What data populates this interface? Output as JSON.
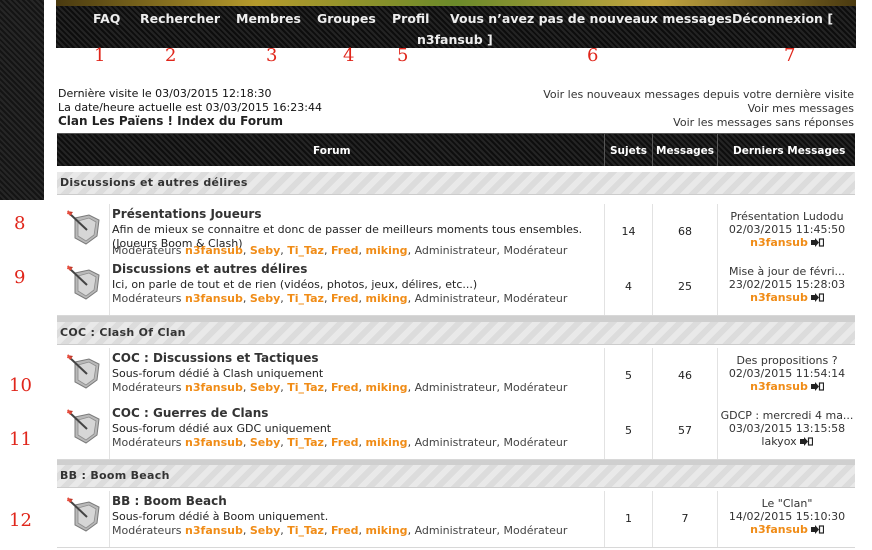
{
  "nav": {
    "faq": "FAQ",
    "search": "Rechercher",
    "members": "Membres",
    "groups": "Groupes",
    "profile": "Profil",
    "messages": "Vous n’avez pas de nouveaux messages",
    "logout_line1": "Déconnexion [",
    "logout_line2": "n3fansub ]"
  },
  "annotations": [
    "1",
    "2",
    "3",
    "4",
    "5",
    "6",
    "7",
    "8",
    "9",
    "10",
    "11",
    "12"
  ],
  "info": {
    "last_visit": "Dernière visite le 03/03/2015 12:18:30",
    "current_time": "La date/heure actuelle est 03/03/2015 16:23:44",
    "breadcrumb": "Clan Les Païens ! Index du Forum",
    "link_new": "Voir les nouveaux messages depuis votre dernière visite",
    "link_mine": "Voir mes messages",
    "link_unanswered": "Voir les messages sans réponses"
  },
  "table_header": {
    "forum": "Forum",
    "topics": "Sujets",
    "messages": "Messages",
    "last": "Derniers Messages"
  },
  "moderators_label": "Modérateurs",
  "moderators": [
    "n3fansub",
    "Seby",
    "Ti_Taz",
    "Fred",
    "miking"
  ],
  "moderator_groups": "Administrateur, Modérateur",
  "categories": [
    {
      "name": "Discussions et autres délires",
      "forums": [
        {
          "title": "Présentations Joueurs",
          "desc": "Afin de mieux se connaitre et donc de passer de meilleurs moments tous ensembles. (Joueurs Boom & Clash)",
          "topics": "14",
          "messages": "68",
          "last_title": "Présentation Ludodu",
          "last_date": "02/03/2015 11:45:50",
          "last_user": "n3fansub"
        },
        {
          "title": "Discussions et autres délires",
          "desc": "Ici, on parle de tout et de rien (vidéos, photos, jeux, délires, etc...)",
          "topics": "4",
          "messages": "25",
          "last_title": "Mise à jour de févri...",
          "last_date": "23/02/2015 15:28:03",
          "last_user": "n3fansub"
        }
      ]
    },
    {
      "name": "COC : Clash Of Clan",
      "forums": [
        {
          "title": "COC : Discussions et Tactiques",
          "desc": "Sous-forum dédié à Clash uniquement",
          "topics": "5",
          "messages": "46",
          "last_title": "Des propositions ?",
          "last_date": "02/03/2015 11:54:14",
          "last_user": "n3fansub"
        },
        {
          "title": "COC : Guerres de Clans",
          "desc": "Sous-forum dédié aux GDC uniquement",
          "topics": "5",
          "messages": "57",
          "last_title": "GDCP : mercredi 4 ma...",
          "last_date": "03/03/2015 13:15:58",
          "last_user": "lakyox"
        }
      ]
    },
    {
      "name": "BB : Boom Beach",
      "forums": [
        {
          "title": "BB : Boom Beach",
          "desc": "Sous-forum dédié à Boom uniquement.",
          "topics": "1",
          "messages": "7",
          "last_title": "Le \"Clan\"",
          "last_date": "14/02/2015 15:10:30",
          "last_user": "n3fansub"
        }
      ]
    }
  ],
  "colors": {
    "moderator": "#f08c17",
    "annotation": "#e0261b"
  },
  "icons": {
    "forum_icon": "shield-arrow-icon",
    "go_icon": "go-to-last-post-icon"
  }
}
